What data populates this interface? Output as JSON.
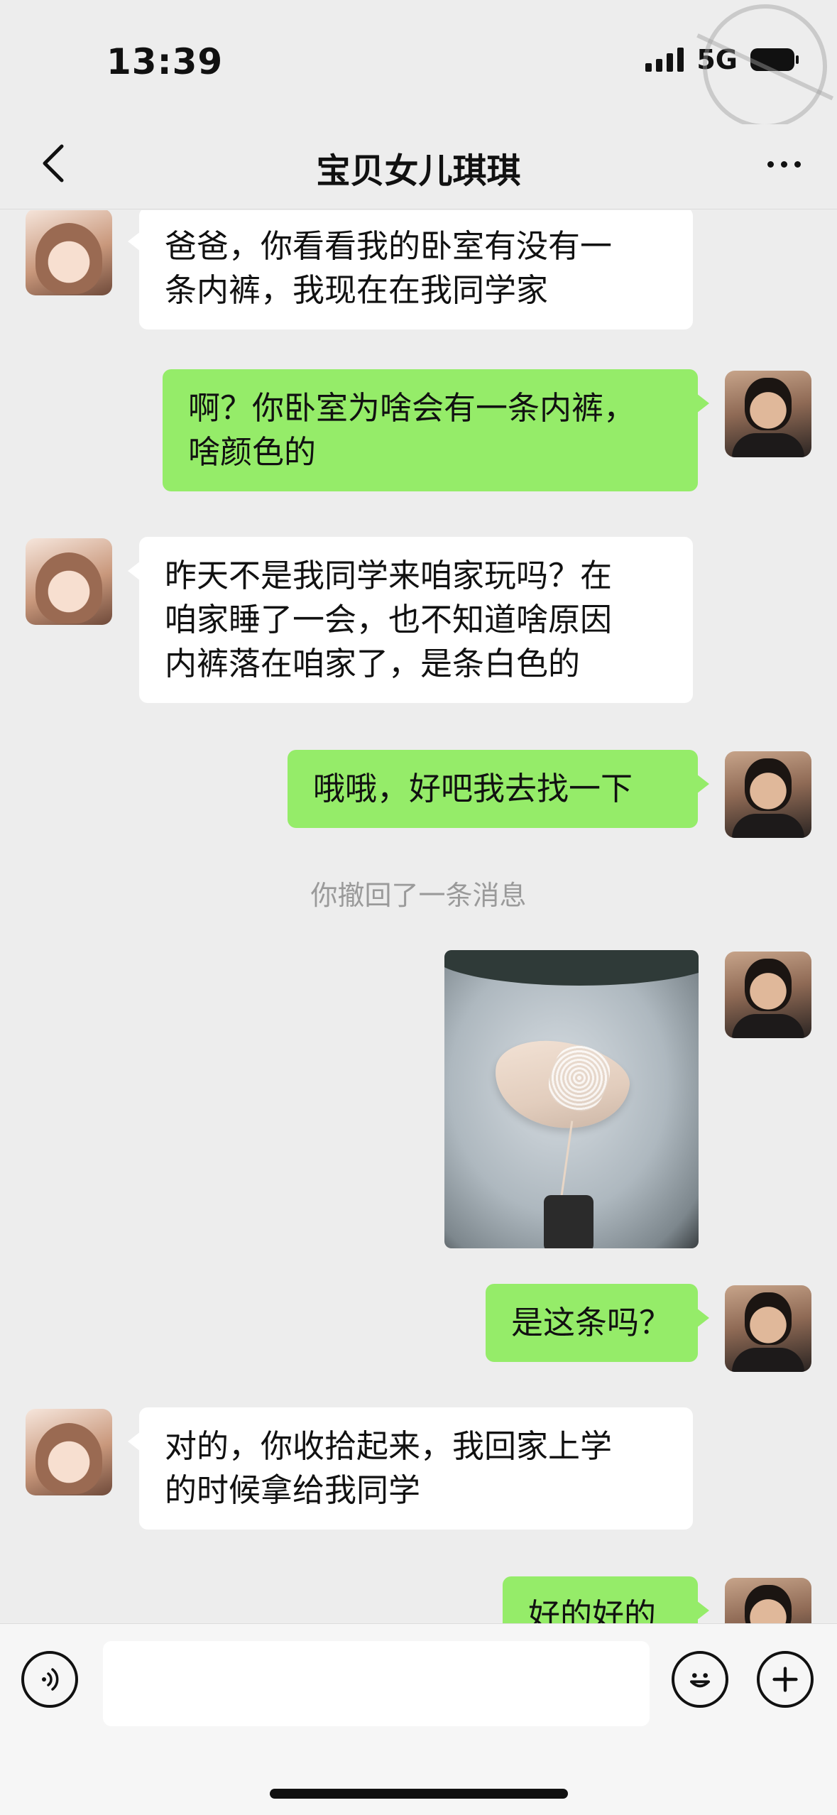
{
  "status_bar": {
    "time": "13:39",
    "network": "5G"
  },
  "header": {
    "title": "宝贝女儿琪琪"
  },
  "messages": [
    {
      "sender": "daughter",
      "lines": [
        "爸爸，你看看我的卧室有没有一",
        "条内裤，我现在在我同学家"
      ]
    },
    {
      "sender": "me",
      "lines": [
        "啊？你卧室为啥会有一条内裤，",
        "啥颜色的"
      ]
    },
    {
      "sender": "daughter",
      "lines": [
        "昨天不是我同学来咱家玩吗？在",
        "咱家睡了一会，也不知道啥原因",
        "内裤落在咱家了，是条白色的"
      ]
    },
    {
      "sender": "me",
      "lines": [
        "哦哦，好吧我去找一下"
      ]
    },
    {
      "sender": "system",
      "text": "你撤回了一条消息"
    },
    {
      "sender": "me",
      "type": "image"
    },
    {
      "sender": "me",
      "lines": [
        "是这条吗？"
      ]
    },
    {
      "sender": "daughter",
      "lines": [
        "对的，你收拾起来，我回家上学",
        "的时候拿给我同学"
      ]
    },
    {
      "sender": "me",
      "lines": [
        "好的好的"
      ]
    }
  ],
  "input_bar": {
    "placeholder": ""
  },
  "icons": {
    "back": "chevron-left-icon",
    "more": "more-icon",
    "voice": "voice-icon",
    "emoji": "emoji-icon",
    "plus": "plus-icon"
  },
  "colors": {
    "background": "#ededed",
    "outgoing_bubble": "#95ec69",
    "incoming_bubble": "#ffffff"
  }
}
